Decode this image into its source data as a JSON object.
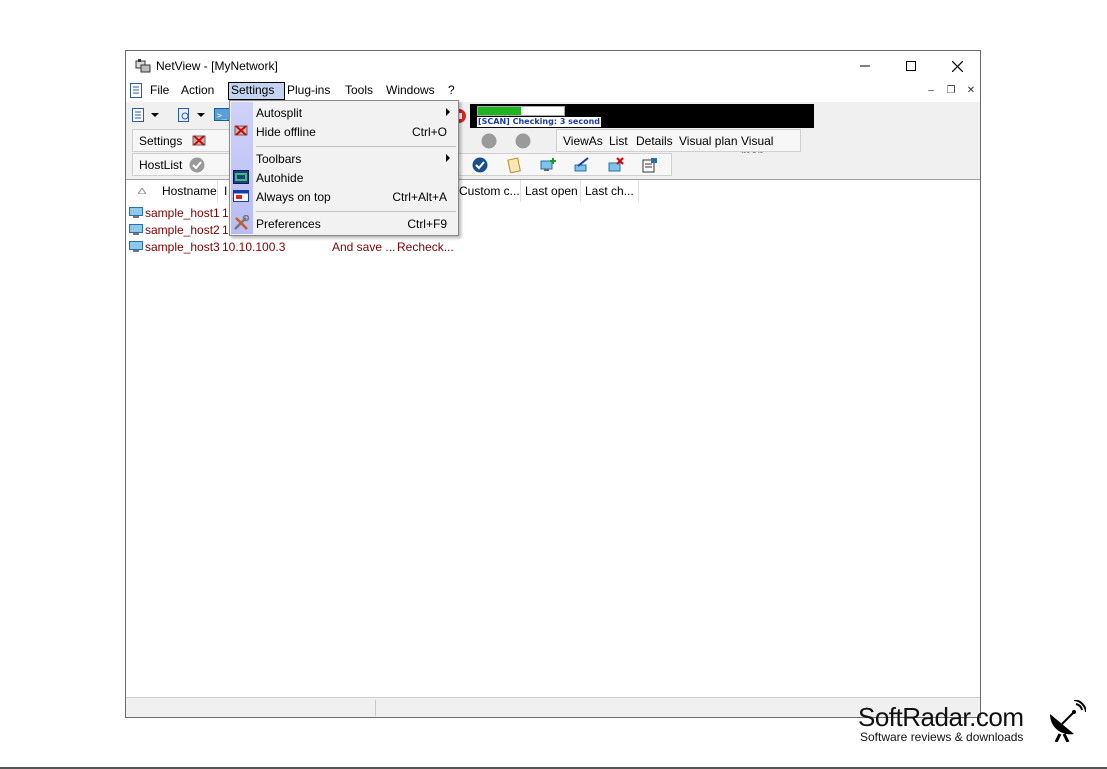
{
  "window": {
    "title": "NetView - [MyNetwork]"
  },
  "menubar": {
    "items": [
      "File",
      "Action",
      "Settings",
      "Plug-ins",
      "Tools",
      "Windows",
      "?"
    ],
    "active": "Settings"
  },
  "scan": {
    "progress": 0.5,
    "text": "[SCAN] Checking: 3 second"
  },
  "toolbars": {
    "settings_label": "Settings",
    "viewas_label": "ViewAs",
    "viewas_items": [
      "List",
      "Details",
      "Visual plan",
      "Visual map"
    ],
    "hostlist_label": "HostList"
  },
  "settings_menu": {
    "items": [
      {
        "label": "Autosplit",
        "shortcut": "",
        "submenu": true
      },
      {
        "label": "Hide offline",
        "shortcut": "Ctrl+O",
        "submenu": false
      },
      {
        "label": "Toolbars",
        "shortcut": "",
        "submenu": true
      },
      {
        "label": "Autohide",
        "shortcut": "",
        "submenu": false
      },
      {
        "label": "Always on top",
        "shortcut": "Ctrl+Alt+A",
        "submenu": false
      },
      {
        "label": "Preferences",
        "shortcut": "Ctrl+F9",
        "submenu": false
      }
    ]
  },
  "list": {
    "columns": [
      "Hostname",
      "I",
      "Custom c...",
      "Last open",
      "Last ch..."
    ],
    "rows": [
      {
        "hostname": "sample_host1",
        "ip": "1",
        "desc": "",
        "status": ""
      },
      {
        "hostname": "sample_host2",
        "ip": "1",
        "desc": "",
        "status": ""
      },
      {
        "hostname": "sample_host3",
        "ip": "10.10.100.3",
        "desc": "And save ...",
        "status": "Recheck..."
      }
    ]
  },
  "watermark": {
    "title": "SoftRadar.com",
    "subtitle": "Software reviews & downloads"
  },
  "colors": {
    "menu_strip": "#c4c9f5",
    "host_text": "#800000",
    "progress": "#1db41d",
    "scan_text": "#1a3aa8"
  }
}
